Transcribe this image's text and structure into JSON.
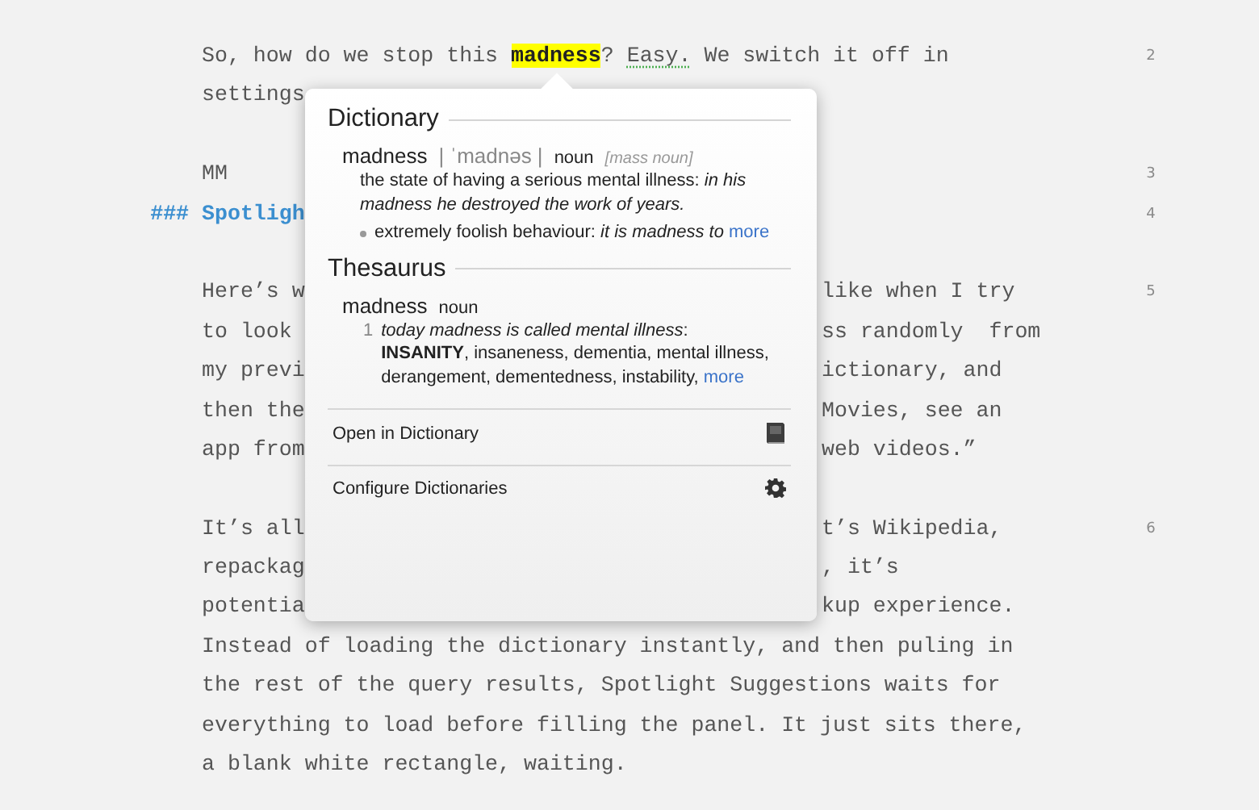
{
  "editor": {
    "paragraphs": [
      {
        "number": "2",
        "lines": [
          [
            {
              "kind": "plain",
              "text": "So, how do we stop this "
            },
            {
              "kind": "highlight",
              "text": "madness"
            },
            {
              "kind": "plain",
              "text": "? "
            },
            {
              "kind": "misspelled",
              "text": "Easy."
            },
            {
              "kind": "plain",
              "text": " We switch it off in"
            }
          ],
          [
            {
              "kind": "plain",
              "text": "settings"
            }
          ]
        ]
      },
      {
        "kind": "blank"
      },
      {
        "number": "3",
        "lines": [
          [
            {
              "kind": "plain",
              "text": "MM"
            }
          ]
        ]
      },
      {
        "number": "4",
        "lines": [
          [
            {
              "kind": "heading",
              "text": "### Spotligh"
            }
          ]
        ]
      },
      {
        "kind": "blank"
      },
      {
        "number": "5",
        "lines": [
          [
            {
              "kind": "plain",
              "text": "Here’s w"
            },
            {
              "kind": "tail",
              "text": "like when I try"
            }
          ],
          [
            {
              "kind": "plain",
              "text": "to look"
            },
            {
              "kind": "tail",
              "text": "ss randomly  from"
            }
          ],
          [
            {
              "kind": "plain",
              "text": "my previ"
            },
            {
              "kind": "tail",
              "text": "ictionary, and"
            }
          ],
          [
            {
              "kind": "plain",
              "text": "then the"
            },
            {
              "kind": "tail",
              "text": "Movies, see an"
            }
          ],
          [
            {
              "kind": "plain",
              "text": "app from"
            },
            {
              "kind": "tail",
              "text": "web videos.”"
            }
          ]
        ]
      },
      {
        "kind": "blank"
      },
      {
        "number": "6",
        "lines": [
          [
            {
              "kind": "plain",
              "text": "It’s all"
            },
            {
              "kind": "tail",
              "text": "t’s Wikipedia,"
            }
          ],
          [
            {
              "kind": "plain",
              "text": "repackag"
            },
            {
              "kind": "tail",
              "text": ", it’s"
            }
          ],
          [
            {
              "kind": "plain",
              "text": "potentia"
            },
            {
              "kind": "tail",
              "text": "kup experience."
            }
          ],
          [
            {
              "kind": "plain",
              "text": "Instead of loading the dictionary instantly, and then puling in"
            }
          ],
          [
            {
              "kind": "plain",
              "text": "the rest of the query results, Spotlight Suggestions waits for"
            }
          ],
          [
            {
              "kind": "plain",
              "text": "everything to load before filling the panel. It just sits there,"
            }
          ],
          [
            {
              "kind": "plain",
              "text": "a blank white rectangle, waiting."
            }
          ]
        ]
      }
    ]
  },
  "popup": {
    "sections": [
      {
        "title": "Dictionary",
        "entry": {
          "headword": "madness",
          "pronunciation": "| ˈmadnəs |",
          "part_of_speech": "noun",
          "grammar": "[mass noun]"
        },
        "senses": [
          {
            "kind": "main",
            "text": "the state of having a serious mental illness: *in his madness he destroyed the work of years.*"
          },
          {
            "kind": "bullet",
            "text": "extremely foolish behaviour: *it is madness to*",
            "link": "more"
          }
        ]
      },
      {
        "title": "Thesaurus",
        "entry": {
          "headword": "madness",
          "part_of_speech": "noun"
        },
        "senses": [
          {
            "kind": "numbered",
            "number": "1",
            "text": "*today madness is called mental illness*:",
            "synonyms": "**INSANITY**, insaneness, dementia, mental illness, derangement, dementedness, instability,",
            "link": "more"
          }
        ]
      }
    ],
    "actions": [
      {
        "label": "Open in Dictionary"
      },
      {
        "label": "Configure Dictionaries"
      }
    ]
  }
}
